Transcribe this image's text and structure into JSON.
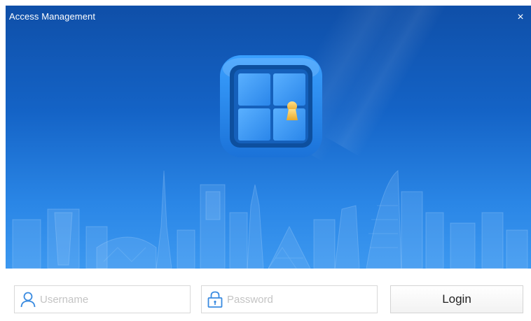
{
  "window": {
    "title": "Access Management",
    "close_glyph": "×",
    "close_icon": "close-icon"
  },
  "banner": {
    "icon": "door-keyhole-icon",
    "colors": {
      "top": "#0f4fa8",
      "bottom": "#3c98f0",
      "icon_frame": "#1e88f0",
      "keyhole": "#f2c34a"
    }
  },
  "login_form": {
    "username": {
      "placeholder": "Username",
      "value": "",
      "icon": "user-icon"
    },
    "password": {
      "placeholder": "Password",
      "value": "",
      "icon": "lock-icon"
    },
    "login_label": "Login"
  }
}
